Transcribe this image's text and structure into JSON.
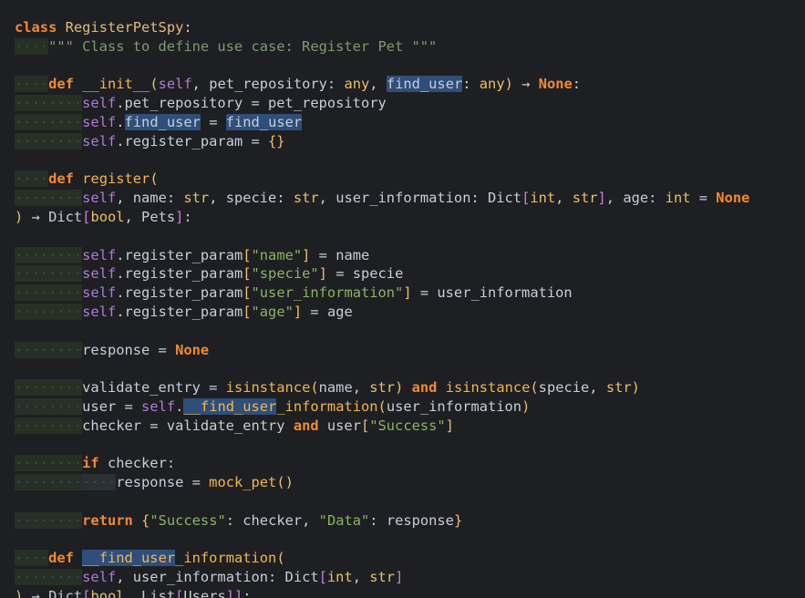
{
  "editor": {
    "language": "python",
    "lines": [
      [
        {
          "t": "",
          "ws": 0
        },
        {
          "c": "kw",
          "v": "class"
        },
        {
          "c": "op",
          "v": " "
        },
        {
          "c": "cls",
          "v": "RegisterPetSpy"
        },
        {
          "c": "op",
          "v": ":"
        }
      ],
      [
        {
          "ws": 1
        },
        {
          "c": "doc",
          "v": "\"\"\" Class to define use case: Register Pet \"\"\""
        }
      ],
      [],
      [
        {
          "ws": 1
        },
        {
          "c": "kw",
          "v": "def"
        },
        {
          "c": "op",
          "v": " "
        },
        {
          "c": "fn",
          "v": "__init__"
        },
        {
          "c": "br1",
          "v": "("
        },
        {
          "c": "self",
          "v": "self"
        },
        {
          "c": "op",
          "v": ", pet_repository: "
        },
        {
          "c": "type",
          "v": "any"
        },
        {
          "c": "op",
          "v": ", "
        },
        {
          "c": "param hl",
          "v": "find_user"
        },
        {
          "c": "op",
          "v": ": "
        },
        {
          "c": "type",
          "v": "any"
        },
        {
          "c": "br1",
          "v": ")"
        },
        {
          "c": "op",
          "v": " → "
        },
        {
          "c": "none",
          "v": "None"
        },
        {
          "c": "op",
          "v": ":"
        }
      ],
      [
        {
          "ws": 2
        },
        {
          "c": "self",
          "v": "self"
        },
        {
          "c": "op",
          "v": ".pet_repository = pet_repository"
        }
      ],
      [
        {
          "ws": 2
        },
        {
          "c": "self",
          "v": "self"
        },
        {
          "c": "op",
          "v": "."
        },
        {
          "c": "param hl",
          "v": "find_user"
        },
        {
          "c": "op",
          "v": " = "
        },
        {
          "c": "param hl",
          "v": "find_user"
        }
      ],
      [
        {
          "ws": 2
        },
        {
          "c": "self",
          "v": "self"
        },
        {
          "c": "op",
          "v": ".register_param = "
        },
        {
          "c": "br1",
          "v": "{}"
        }
      ],
      [],
      [
        {
          "ws": 1
        },
        {
          "c": "kw",
          "v": "def"
        },
        {
          "c": "op",
          "v": " "
        },
        {
          "c": "fn",
          "v": "register"
        },
        {
          "c": "br1",
          "v": "("
        }
      ],
      [
        {
          "ws": 2
        },
        {
          "c": "self",
          "v": "self"
        },
        {
          "c": "op",
          "v": ", name: "
        },
        {
          "c": "type",
          "v": "str"
        },
        {
          "c": "op",
          "v": ", specie: "
        },
        {
          "c": "type",
          "v": "str"
        },
        {
          "c": "op",
          "v": ", user_information: Dict"
        },
        {
          "c": "br2",
          "v": "["
        },
        {
          "c": "type",
          "v": "int"
        },
        {
          "c": "op",
          "v": ", "
        },
        {
          "c": "type",
          "v": "str"
        },
        {
          "c": "br2",
          "v": "]"
        },
        {
          "c": "op",
          "v": ", age: "
        },
        {
          "c": "type",
          "v": "int"
        },
        {
          "c": "op",
          "v": " = "
        },
        {
          "c": "none",
          "v": "None"
        }
      ],
      [
        {
          "ws": 0
        },
        {
          "c": "br1",
          "v": ")"
        },
        {
          "c": "op",
          "v": " → Dict"
        },
        {
          "c": "br2",
          "v": "["
        },
        {
          "c": "type",
          "v": "bool"
        },
        {
          "c": "op",
          "v": ", Pets"
        },
        {
          "c": "br2",
          "v": "]"
        },
        {
          "c": "op",
          "v": ":"
        }
      ],
      [],
      [
        {
          "ws": 2
        },
        {
          "c": "self",
          "v": "self"
        },
        {
          "c": "op",
          "v": ".register_param"
        },
        {
          "c": "br1",
          "v": "["
        },
        {
          "c": "str",
          "v": "\"name\""
        },
        {
          "c": "br1",
          "v": "]"
        },
        {
          "c": "op",
          "v": " = name"
        }
      ],
      [
        {
          "ws": 2
        },
        {
          "c": "self",
          "v": "self"
        },
        {
          "c": "op",
          "v": ".register_param"
        },
        {
          "c": "br1",
          "v": "["
        },
        {
          "c": "str",
          "v": "\"specie\""
        },
        {
          "c": "br1",
          "v": "]"
        },
        {
          "c": "op",
          "v": " = specie"
        }
      ],
      [
        {
          "ws": 2
        },
        {
          "c": "self",
          "v": "self"
        },
        {
          "c": "op",
          "v": ".register_param"
        },
        {
          "c": "br1",
          "v": "["
        },
        {
          "c": "str",
          "v": "\"user_information\""
        },
        {
          "c": "br1",
          "v": "]"
        },
        {
          "c": "op",
          "v": " = user_information"
        }
      ],
      [
        {
          "ws": 2
        },
        {
          "c": "self",
          "v": "self"
        },
        {
          "c": "op",
          "v": ".register_param"
        },
        {
          "c": "br1",
          "v": "["
        },
        {
          "c": "str",
          "v": "\"age\""
        },
        {
          "c": "br1",
          "v": "]"
        },
        {
          "c": "op",
          "v": " = age"
        }
      ],
      [],
      [
        {
          "ws": 2
        },
        {
          "c": "op",
          "v": "response = "
        },
        {
          "c": "none",
          "v": "None"
        }
      ],
      [],
      [
        {
          "ws": 2
        },
        {
          "c": "op",
          "v": "validate_entry = "
        },
        {
          "c": "fn",
          "v": "isinstance"
        },
        {
          "c": "br1",
          "v": "("
        },
        {
          "c": "op",
          "v": "name, "
        },
        {
          "c": "type",
          "v": "str"
        },
        {
          "c": "br1",
          "v": ")"
        },
        {
          "c": "op",
          "v": " "
        },
        {
          "c": "kw",
          "v": "and"
        },
        {
          "c": "op",
          "v": " "
        },
        {
          "c": "fn",
          "v": "isinstance"
        },
        {
          "c": "br1",
          "v": "("
        },
        {
          "c": "op",
          "v": "specie, "
        },
        {
          "c": "type",
          "v": "str"
        },
        {
          "c": "br1",
          "v": ")"
        }
      ],
      [
        {
          "ws": 2
        },
        {
          "c": "op",
          "v": "user = "
        },
        {
          "c": "self",
          "v": "self"
        },
        {
          "c": "op",
          "v": "."
        },
        {
          "c": "fn hl",
          "v": "__find_user"
        },
        {
          "c": "fn",
          "v": "_information"
        },
        {
          "c": "br1",
          "v": "("
        },
        {
          "c": "op",
          "v": "user_information"
        },
        {
          "c": "br1",
          "v": ")"
        }
      ],
      [
        {
          "ws": 2
        },
        {
          "c": "op",
          "v": "checker = validate_entry "
        },
        {
          "c": "kw",
          "v": "and"
        },
        {
          "c": "op",
          "v": " user"
        },
        {
          "c": "br1",
          "v": "["
        },
        {
          "c": "str",
          "v": "\"Success\""
        },
        {
          "c": "br1",
          "v": "]"
        }
      ],
      [],
      [
        {
          "ws": 2
        },
        {
          "c": "kw",
          "v": "if"
        },
        {
          "c": "op",
          "v": " checker:"
        }
      ],
      [
        {
          "ws": 3
        },
        {
          "c": "op",
          "v": "response = "
        },
        {
          "c": "fn",
          "v": "mock_pet"
        },
        {
          "c": "br1",
          "v": "()"
        }
      ],
      [],
      [
        {
          "ws": 2
        },
        {
          "c": "kw",
          "v": "return"
        },
        {
          "c": "op",
          "v": " "
        },
        {
          "c": "br1",
          "v": "{"
        },
        {
          "c": "str",
          "v": "\"Success\""
        },
        {
          "c": "op",
          "v": ": checker, "
        },
        {
          "c": "str",
          "v": "\"Data\""
        },
        {
          "c": "op",
          "v": ": response"
        },
        {
          "c": "br1",
          "v": "}"
        }
      ],
      [],
      [
        {
          "ws": 1
        },
        {
          "c": "kw",
          "v": "def"
        },
        {
          "c": "op",
          "v": " "
        },
        {
          "c": "fn hl",
          "v": "__find_user"
        },
        {
          "c": "fn",
          "v": "_information"
        },
        {
          "c": "br1",
          "v": "("
        }
      ],
      [
        {
          "ws": 2
        },
        {
          "c": "self",
          "v": "self"
        },
        {
          "c": "op",
          "v": ", user_information: Dict"
        },
        {
          "c": "br2",
          "v": "["
        },
        {
          "c": "type",
          "v": "int"
        },
        {
          "c": "op",
          "v": ", "
        },
        {
          "c": "type",
          "v": "str"
        },
        {
          "c": "br2",
          "v": "]"
        }
      ],
      [
        {
          "ws": 0
        },
        {
          "c": "br1",
          "v": ")"
        },
        {
          "c": "op",
          "v": " → Dict"
        },
        {
          "c": "br2",
          "v": "["
        },
        {
          "c": "type",
          "v": "bool"
        },
        {
          "c": "op",
          "v": ", List"
        },
        {
          "c": "br2",
          "v": "["
        },
        {
          "c": "op",
          "v": "Users"
        },
        {
          "c": "br2",
          "v": "]]"
        },
        {
          "c": "op",
          "v": ":"
        }
      ]
    ]
  }
}
